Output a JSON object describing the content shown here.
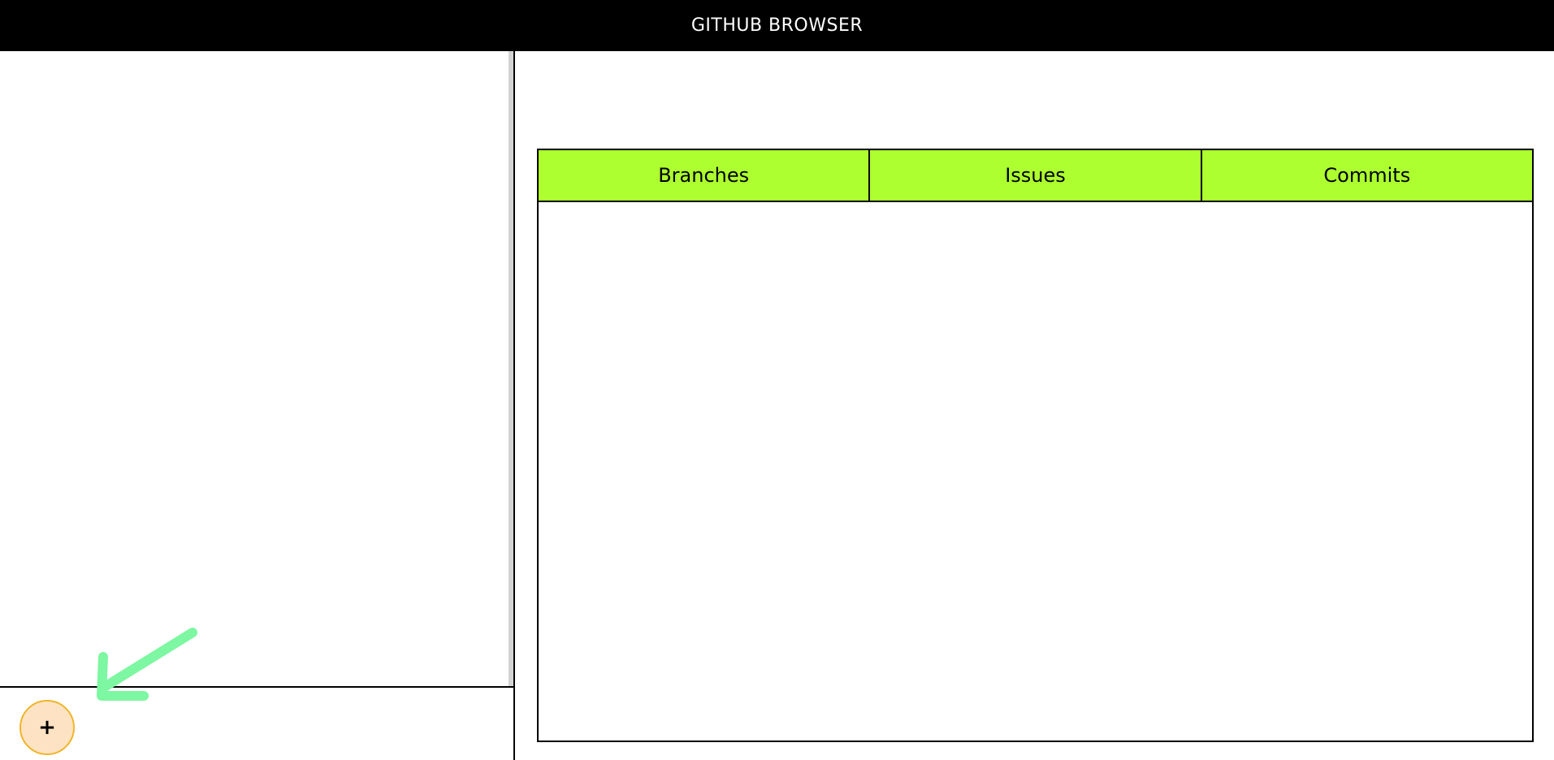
{
  "app": {
    "title": "GITHUB BROWSER"
  },
  "sidebar": {
    "add_button_label": "+",
    "add_button_icon": "plus-icon"
  },
  "annotation": {
    "icon": "arrow-pointer-icon",
    "color": "#7df7a1"
  },
  "tabs": [
    {
      "label": "Branches"
    },
    {
      "label": "Issues"
    },
    {
      "label": "Commits"
    }
  ],
  "colors": {
    "titlebar_bg": "#000000",
    "tab_bg": "#adff2f",
    "add_button_bg": "#fde3c4",
    "add_button_border": "#f0b429"
  }
}
